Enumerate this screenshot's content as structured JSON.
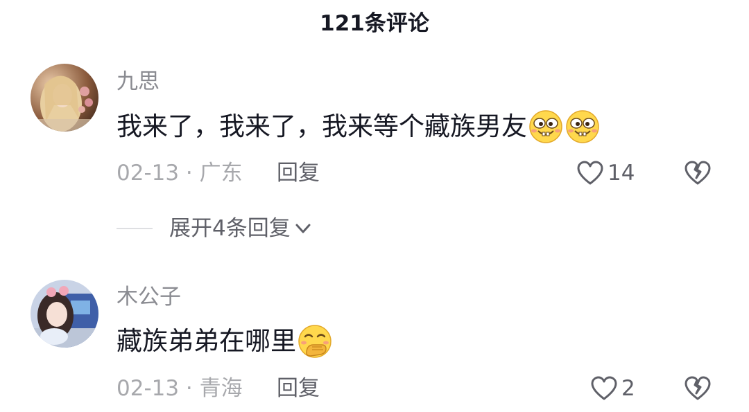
{
  "header": {
    "title": "121条评论"
  },
  "comments": [
    {
      "username": "九思",
      "text": "我来了，我来了，我来等个藏族男友",
      "emojis": [
        "smirk-grin-emoji",
        "smirk-grin-emoji"
      ],
      "date_location": "02-13 · 广东",
      "reply_label": "回复",
      "likes": "14",
      "expand_label": "展开4条回复"
    },
    {
      "username": "木公子",
      "text": "藏族弟弟在哪里",
      "emojis": [
        "hand-over-mouth-emoji"
      ],
      "date_location": "02-13 · 青海",
      "reply_label": "回复",
      "likes": "2"
    }
  ],
  "colors": {
    "text_primary": "#161823",
    "text_secondary": "#8a8b91",
    "text_meta": "#a7a8ac",
    "icon": "#5f6068"
  }
}
